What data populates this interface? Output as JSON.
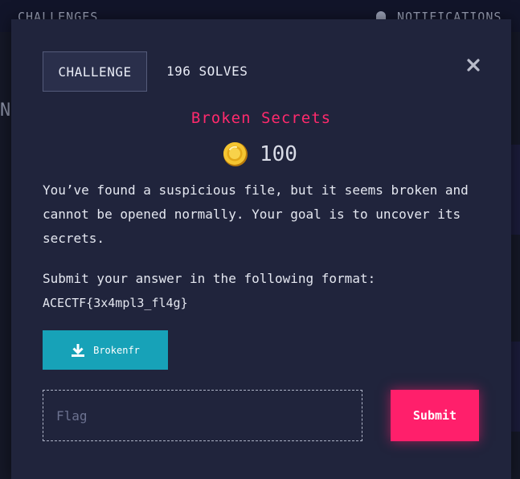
{
  "background": {
    "nav_left": "CHALLENGES",
    "nav_right": "NOTIFICATIONS",
    "side_glyph": "N"
  },
  "modal": {
    "tabs": {
      "challenge": "CHALLENGE",
      "solves": "196 SOLVES"
    },
    "close_icon": "close-icon",
    "title": "Broken Secrets",
    "points": "100",
    "coin_icon": "coin-icon",
    "description": "You’ve found a suspicious file, but it seems broken and cannot be opened normally. Your goal is to uncover its secrets.",
    "format_text": "Submit your answer in the following format:",
    "format_example": "ACECTF{3x4mpl3_fl4g}",
    "file": {
      "icon": "download-icon",
      "name": "Brokenfr"
    },
    "flag_input": {
      "placeholder": "Flag",
      "value": ""
    },
    "submit_label": "Submit"
  },
  "colors": {
    "accent": "#ff2a6d",
    "submit": "#ff1f6b",
    "download": "#17a2b8",
    "modal_bg": "#20243c"
  }
}
